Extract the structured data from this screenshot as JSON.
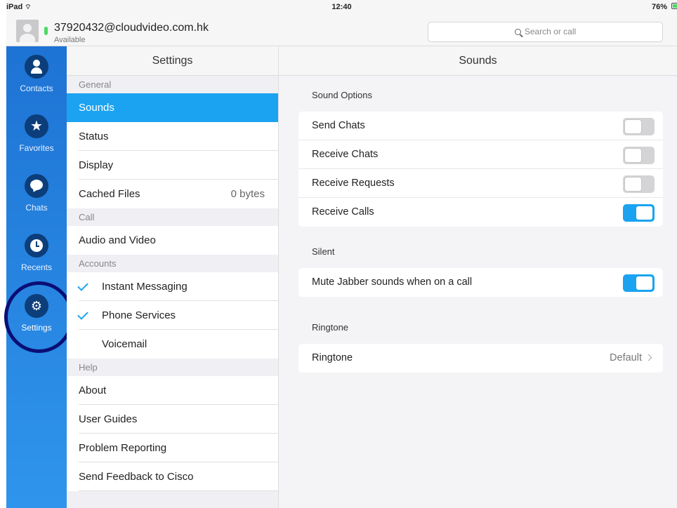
{
  "status_bar": {
    "device": "iPad",
    "time": "12:40",
    "battery": "76%",
    "battery_level": 0.76
  },
  "header": {
    "account": "37920432@cloudvideo.com.hk",
    "availability": "Available",
    "search_placeholder": "Search or call"
  },
  "nav": {
    "items": [
      {
        "label": "Contacts",
        "icon": "person-icon"
      },
      {
        "label": "Favorites",
        "icon": "star-icon"
      },
      {
        "label": "Chats",
        "icon": "chat-bubble-icon"
      },
      {
        "label": "Recents",
        "icon": "clock-icon"
      },
      {
        "label": "Settings",
        "icon": "gear-icon"
      }
    ],
    "active": "Settings"
  },
  "settings": {
    "title": "Settings",
    "sections": [
      {
        "header": "General",
        "rows": [
          {
            "label": "Sounds",
            "selected": true
          },
          {
            "label": "Status"
          },
          {
            "label": "Display"
          },
          {
            "label": "Cached Files",
            "detail": "0 bytes"
          }
        ]
      },
      {
        "header": "Call",
        "rows": [
          {
            "label": "Audio and Video"
          }
        ]
      },
      {
        "header": "Accounts",
        "rows": [
          {
            "label": "Instant Messaging",
            "checked": true
          },
          {
            "label": "Phone Services",
            "checked": true
          },
          {
            "label": "Voicemail"
          }
        ]
      },
      {
        "header": "Help",
        "rows": [
          {
            "label": "About"
          },
          {
            "label": "User Guides"
          },
          {
            "label": "Problem Reporting"
          },
          {
            "label": "Send Feedback to Cisco"
          }
        ]
      }
    ]
  },
  "sounds": {
    "title": "Sounds",
    "sound_options": {
      "label": "Sound Options",
      "rows": [
        {
          "label": "Send Chats",
          "on": false
        },
        {
          "label": "Receive Chats",
          "on": false
        },
        {
          "label": "Receive Requests",
          "on": false
        },
        {
          "label": "Receive Calls",
          "on": true
        }
      ]
    },
    "silent": {
      "label": "Silent",
      "rows": [
        {
          "label": "Mute Jabber sounds when on a call",
          "on": true
        }
      ]
    },
    "ringtone": {
      "label": "Ringtone",
      "row_label": "Ringtone",
      "value": "Default"
    }
  },
  "colors": {
    "accent": "#1ba3f1",
    "nav_top": "#1e73d4",
    "nav_bottom": "#2f95ec",
    "nav_circle": "#0b3e7a",
    "highlight_ring": "#0a0f75"
  }
}
